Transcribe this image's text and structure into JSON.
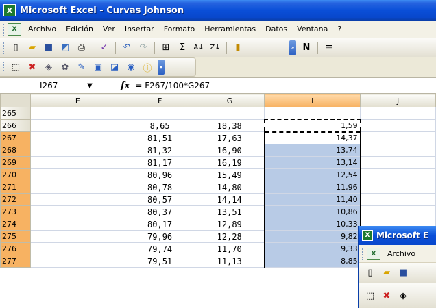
{
  "window": {
    "title": "Microsoft Excel - Curvas Johnson",
    "logo_letter": "X"
  },
  "menu": {
    "items": [
      "Archivo",
      "Edición",
      "Ver",
      "Insertar",
      "Formato",
      "Herramientas",
      "Datos",
      "Ventana",
      "?"
    ]
  },
  "toolbar_standard": {
    "icons": [
      "new-icon",
      "open-icon",
      "save-icon",
      "permission-icon",
      "print-icon",
      "spelling-icon",
      "undo-icon",
      "redo-icon",
      "autosum-icon",
      "sort-ascending-icon",
      "sort-descending-icon",
      "chart-wizard-icon"
    ],
    "bold_label": "N"
  },
  "toolbar_drawing": {
    "icons": [
      "select-icon",
      "delete-icon",
      "shapes-icon",
      "diagram-icon",
      "edit-icon",
      "textbox-icon",
      "box-icon",
      "circle-icon",
      "info-icon"
    ]
  },
  "formula_bar": {
    "name_box": "I267",
    "fx": "fx",
    "formula": "= F267/100*G267"
  },
  "sheet": {
    "columns": [
      "E",
      "F",
      "G",
      "I",
      "J"
    ],
    "selected_column": "I",
    "rows": [
      {
        "n": "265",
        "F": "",
        "G": "",
        "I": ""
      },
      {
        "n": "266",
        "F": "8,65",
        "G": "18,38",
        "I": "1,59"
      },
      {
        "n": "267",
        "F": "81,51",
        "G": "17,63",
        "I": "14,37"
      },
      {
        "n": "268",
        "F": "81,32",
        "G": "16,90",
        "I": "13,74"
      },
      {
        "n": "269",
        "F": "81,17",
        "G": "16,19",
        "I": "13,14"
      },
      {
        "n": "270",
        "F": "80,96",
        "G": "15,49",
        "I": "12,54"
      },
      {
        "n": "271",
        "F": "80,78",
        "G": "14,80",
        "I": "11,96"
      },
      {
        "n": "272",
        "F": "80,57",
        "G": "14,14",
        "I": "11,40"
      },
      {
        "n": "273",
        "F": "80,37",
        "G": "13,51",
        "I": "10,86"
      },
      {
        "n": "274",
        "F": "80,17",
        "G": "12,89",
        "I": "10,33"
      },
      {
        "n": "275",
        "F": "79,96",
        "G": "12,28",
        "I": "9,82"
      },
      {
        "n": "276",
        "F": "79,74",
        "G": "11,70",
        "I": "9,33"
      },
      {
        "n": "277",
        "F": "79,51",
        "G": "11,13",
        "I": "8,85"
      }
    ]
  },
  "overlay_window": {
    "title": "Microsoft E",
    "menu_first": "Archivo"
  }
}
